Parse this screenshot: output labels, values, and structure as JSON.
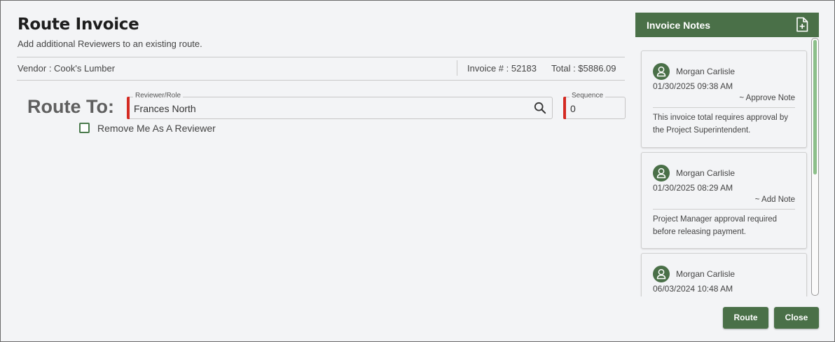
{
  "dialog": {
    "title": "Route Invoice",
    "subtitle": "Add additional Reviewers to an existing route."
  },
  "info": {
    "vendor": "Vendor : Cook's Lumber",
    "invoice": "Invoice # : 52183",
    "total": "Total : $5886.09"
  },
  "route": {
    "label": "Route To:",
    "reviewer_legend": "Reviewer/Role",
    "reviewer_value": "Frances North",
    "sequence_legend": "Sequence",
    "sequence_value": "0",
    "remove_me_label": "Remove Me As A Reviewer",
    "remove_me_checked": false
  },
  "notes": {
    "title": "Invoice Notes",
    "items": [
      {
        "author": "Morgan Carlisle",
        "timestamp": "01/30/2025 09:38 AM",
        "type": "~ Approve Note",
        "body": "This invoice total requires approval by the Project Superintendent."
      },
      {
        "author": "Morgan Carlisle",
        "timestamp": "01/30/2025 08:29 AM",
        "type": "~ Add Note",
        "body": "Project Manager approval required before releasing payment."
      },
      {
        "author": "Morgan Carlisle",
        "timestamp": "06/03/2024 10:48 AM"
      }
    ]
  },
  "buttons": {
    "route": "Route",
    "close": "Close"
  },
  "colors": {
    "accent": "#4a7048",
    "required": "#d42a22",
    "scroll_thumb": "#8cbf8a"
  }
}
